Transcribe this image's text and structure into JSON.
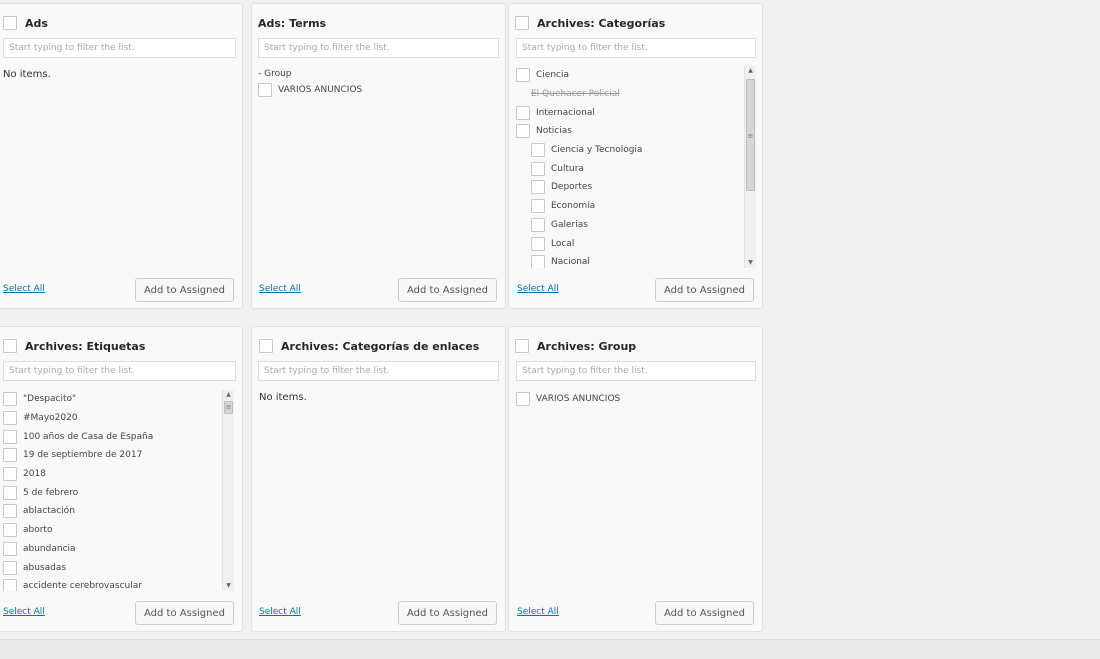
{
  "filter_placeholder": "Start typing to filter the list.",
  "select_all_label": "Select All",
  "add_button_label": "Add to Assigned",
  "empty_label": "No items.",
  "panels": {
    "ads": {
      "title": "Ads"
    },
    "ads_terms": {
      "title": "Ads: Terms",
      "group_label": "- Group",
      "items": [
        "VARIOS ANUNCIOS"
      ]
    },
    "categorias": {
      "title": "Archives: Categorías",
      "items": [
        "Ciencia",
        "El Quehacer Policial",
        "Internacional",
        "Noticias",
        "Ciencia y Tecnologia",
        "Cultura",
        "Deportes",
        "Economía",
        "Galerias",
        "Local",
        "Nacional"
      ]
    },
    "etiquetas": {
      "title": "Archives: Etiquetas",
      "items": [
        "\"Despacito\"",
        "#Mayo2020",
        "100 años de Casa de España",
        "19 de septiembre de 2017",
        "2018",
        "5 de febrero",
        "ablactación",
        "aborto",
        "abundancia",
        "abusadas",
        "accidente cerebrovascular"
      ]
    },
    "enlaces": {
      "title": "Archives: Categorías de enlaces"
    },
    "group": {
      "title": "Archives: Group",
      "items": [
        "VARIOS ANUNCIOS"
      ]
    }
  },
  "icons": {
    "scroll_up": "arrow-up-icon",
    "scroll_down": "arrow-down-icon",
    "grip": "grip-icon"
  }
}
